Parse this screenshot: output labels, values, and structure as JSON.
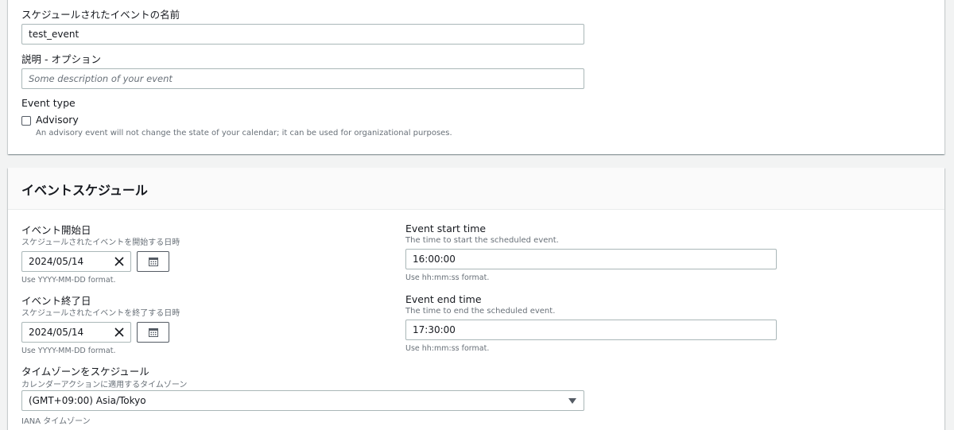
{
  "event_name": {
    "label": "スケジュールされたイベントの名前",
    "value": "test_event"
  },
  "description": {
    "label": "説明 - オプション",
    "placeholder": "Some description of your event"
  },
  "event_type": {
    "label": "Event type",
    "advisory_label": "Advisory",
    "advisory_checked": false,
    "advisory_description": "An advisory event will not change the state of your calendar; it can be used for organizational purposes."
  },
  "schedule_section": {
    "title": "イベントスケジュール",
    "start_date": {
      "label": "イベント開始日",
      "description": "スケジュールされたイベントを開始する日時",
      "value": "2024/05/14",
      "constraint": "Use YYYY-MM-DD format."
    },
    "end_date": {
      "label": "イベント終了日",
      "description": "スケジュールされたイベントを終了する日時",
      "value": "2024/05/14",
      "constraint": "Use YYYY-MM-DD format."
    },
    "start_time": {
      "label": "Event start time",
      "description": "The time to start the scheduled event.",
      "value": "16:00:00",
      "constraint": "Use hh:mm:ss format."
    },
    "end_time": {
      "label": "Event end time",
      "description": "The time to end the scheduled event.",
      "value": "17:30:00",
      "constraint": "Use hh:mm:ss format."
    },
    "timezone": {
      "label": "タイムゾーンをスケジュール",
      "description": "カレンダーアクションに適用するタイムゾーン",
      "value": "(GMT+09:00) Asia/Tokyo",
      "constraint": "IANA タイムゾーン"
    }
  }
}
